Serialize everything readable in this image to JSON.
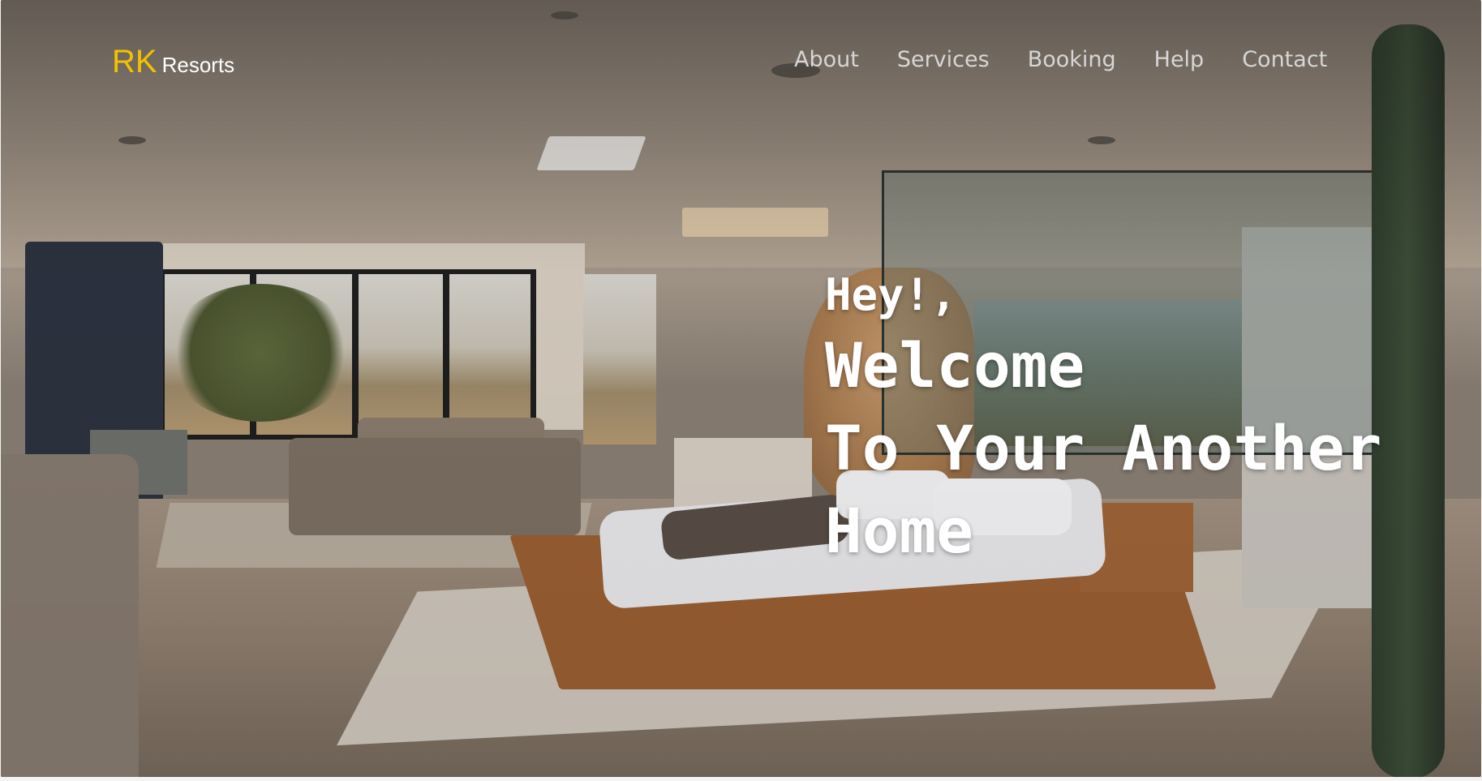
{
  "brand": {
    "primary": "RK",
    "secondary": "Resorts",
    "primary_color": "#f2c200"
  },
  "nav": {
    "items": [
      "About",
      "Services",
      "Booking",
      "Help",
      "Contact"
    ]
  },
  "hero": {
    "greeting": "Hey!,",
    "lines": [
      "Welcome",
      "To Your Another",
      "Home"
    ],
    "background": "bedroom-interior-photo"
  }
}
